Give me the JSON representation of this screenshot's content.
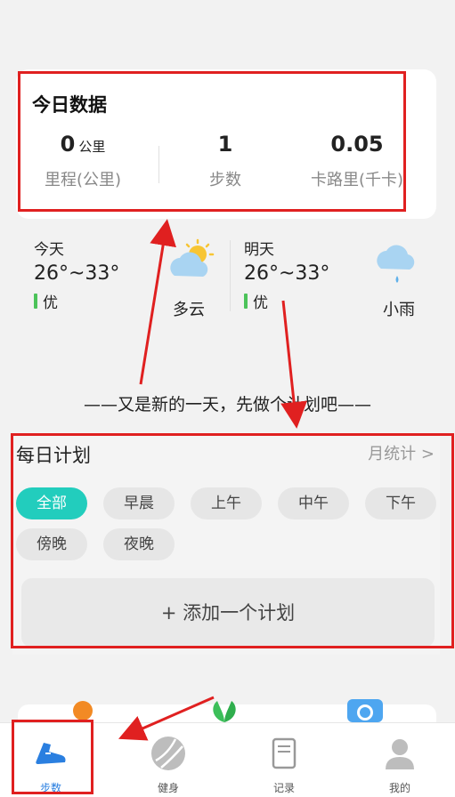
{
  "today": {
    "title": "今日数据",
    "stats": [
      {
        "value": "0",
        "unit": "公里",
        "label": "里程(公里)"
      },
      {
        "value": "1",
        "unit": "",
        "label": "步数"
      },
      {
        "value": "0.05",
        "unit": "",
        "label": "卡路里(千卡)"
      }
    ]
  },
  "weather": {
    "today": {
      "day": "今天",
      "temp": "26°~33°",
      "aqi": "优",
      "condition": "多云",
      "icon": "partly-cloudy-icon"
    },
    "tomorrow": {
      "day": "明天",
      "temp": "26°~33°",
      "aqi": "优",
      "condition": "小雨",
      "icon": "light-rain-icon"
    }
  },
  "slogan": "——又是新的一天，先做个计划吧——",
  "plan": {
    "title": "每日计划",
    "month_stats": "月统计",
    "filters": [
      "全部",
      "早晨",
      "上午",
      "中午",
      "下午",
      "傍晚",
      "夜晚"
    ],
    "active_filter": "全部",
    "add_label": "+ 添加一个计划"
  },
  "tabs": [
    {
      "label": "步数",
      "icon": "running-shoe-icon",
      "active": true
    },
    {
      "label": "健身",
      "icon": "ball-icon",
      "active": false
    },
    {
      "label": "记录",
      "icon": "notebook-icon",
      "active": false
    },
    {
      "label": "我的",
      "icon": "user-icon",
      "active": false
    }
  ],
  "colors": {
    "accent": "#22cdbd",
    "highlight": "#e02020",
    "tab_active": "#2a7fe0",
    "aqi_good": "#4cc35a"
  }
}
